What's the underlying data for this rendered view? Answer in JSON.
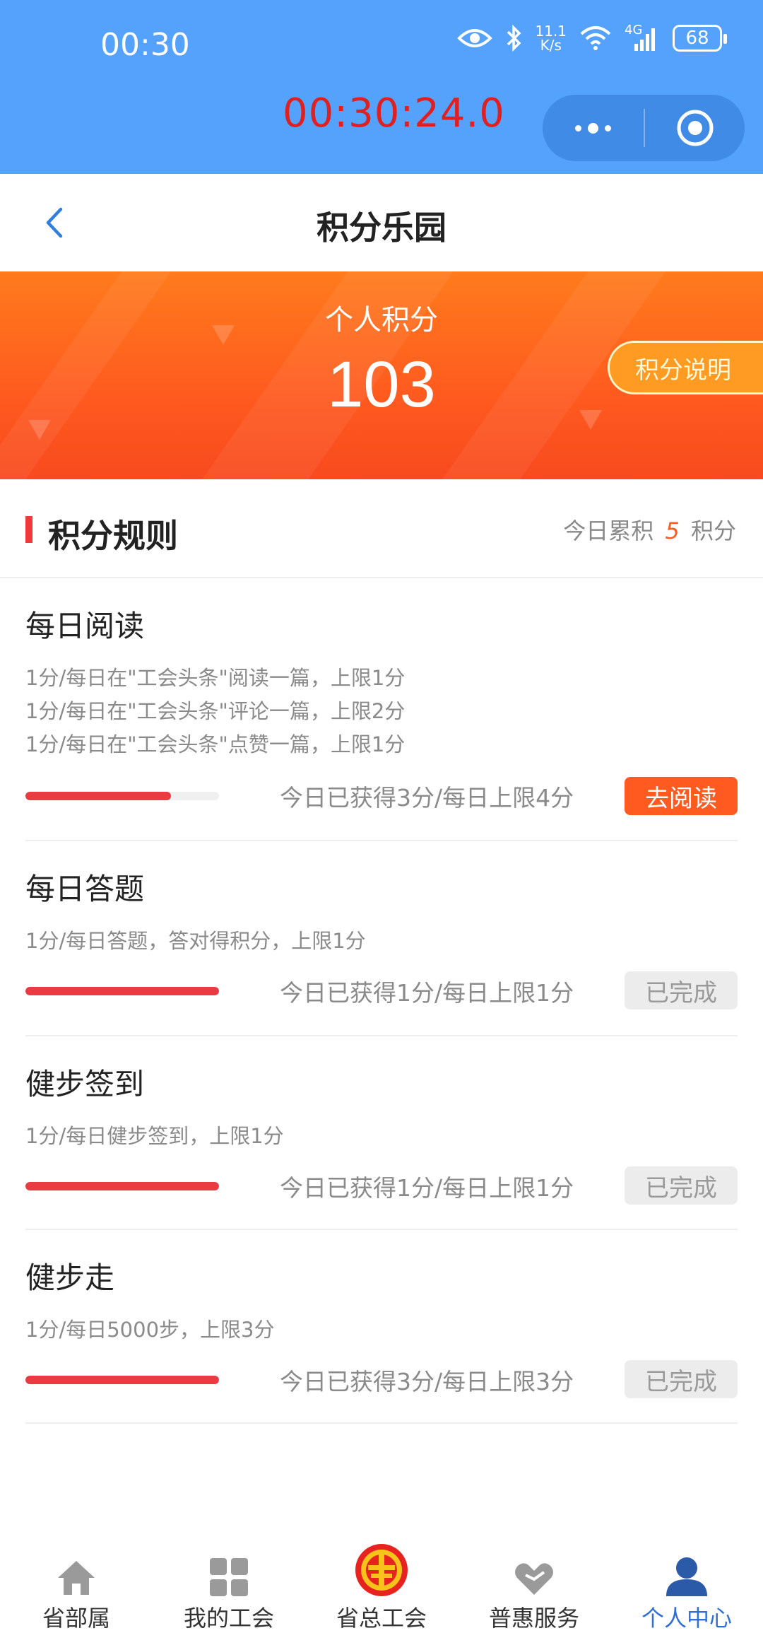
{
  "status_bar": {
    "time": "00:30",
    "net_speed_top": "11.1",
    "net_speed_bottom": "K/s",
    "network": "4G",
    "battery": "68"
  },
  "capsule": {
    "timer": "00:30:24.0"
  },
  "nav": {
    "title": "积分乐园"
  },
  "banner": {
    "label": "个人积分",
    "points": "103",
    "explain_button": "积分说明"
  },
  "rules": {
    "title": "积分规则",
    "today_prefix": "今日累积",
    "today_value": "5",
    "today_suffix": "积分"
  },
  "tasks": [
    {
      "title": "每日阅读",
      "desc": [
        "1分/每日在\"工会头条\"阅读一篇，上限1分",
        "1分/每日在\"工会头条\"评论一篇，上限2分",
        "1分/每日在\"工会头条\"点赞一篇，上限1分"
      ],
      "progress": 0.75,
      "status": "今日已获得3分/每日上限4分",
      "button": "去阅读"
    },
    {
      "title": "每日答题",
      "desc": [
        "1分/每日答题，答对得积分，上限1分"
      ],
      "progress": 1.0,
      "status": "今日已获得1分/每日上限1分",
      "button": "已完成"
    },
    {
      "title": "健步签到",
      "desc": [
        "1分/每日健步签到，上限1分"
      ],
      "progress": 1.0,
      "status": "今日已获得1分/每日上限1分",
      "button": "已完成"
    },
    {
      "title": "健步走",
      "desc": [
        "1分/每日5000步，上限3分"
      ],
      "progress": 1.0,
      "status": "今日已获得3分/每日上限3分",
      "button": "已完成"
    }
  ],
  "tabbar": {
    "items": [
      {
        "label": "省部属",
        "icon": "home-icon"
      },
      {
        "label": "我的工会",
        "icon": "grid-icon"
      },
      {
        "label": "省总工会",
        "icon": "union-emblem-icon"
      },
      {
        "label": "普惠服务",
        "icon": "heart-hand-icon"
      },
      {
        "label": "个人中心",
        "icon": "person-icon",
        "active": true
      }
    ]
  },
  "colors": {
    "status_bar_bg": "#54a2fb",
    "banner_orange": "#ff5a1f",
    "progress_red": "#ea3b43",
    "active_tab": "#2f6fd6"
  }
}
